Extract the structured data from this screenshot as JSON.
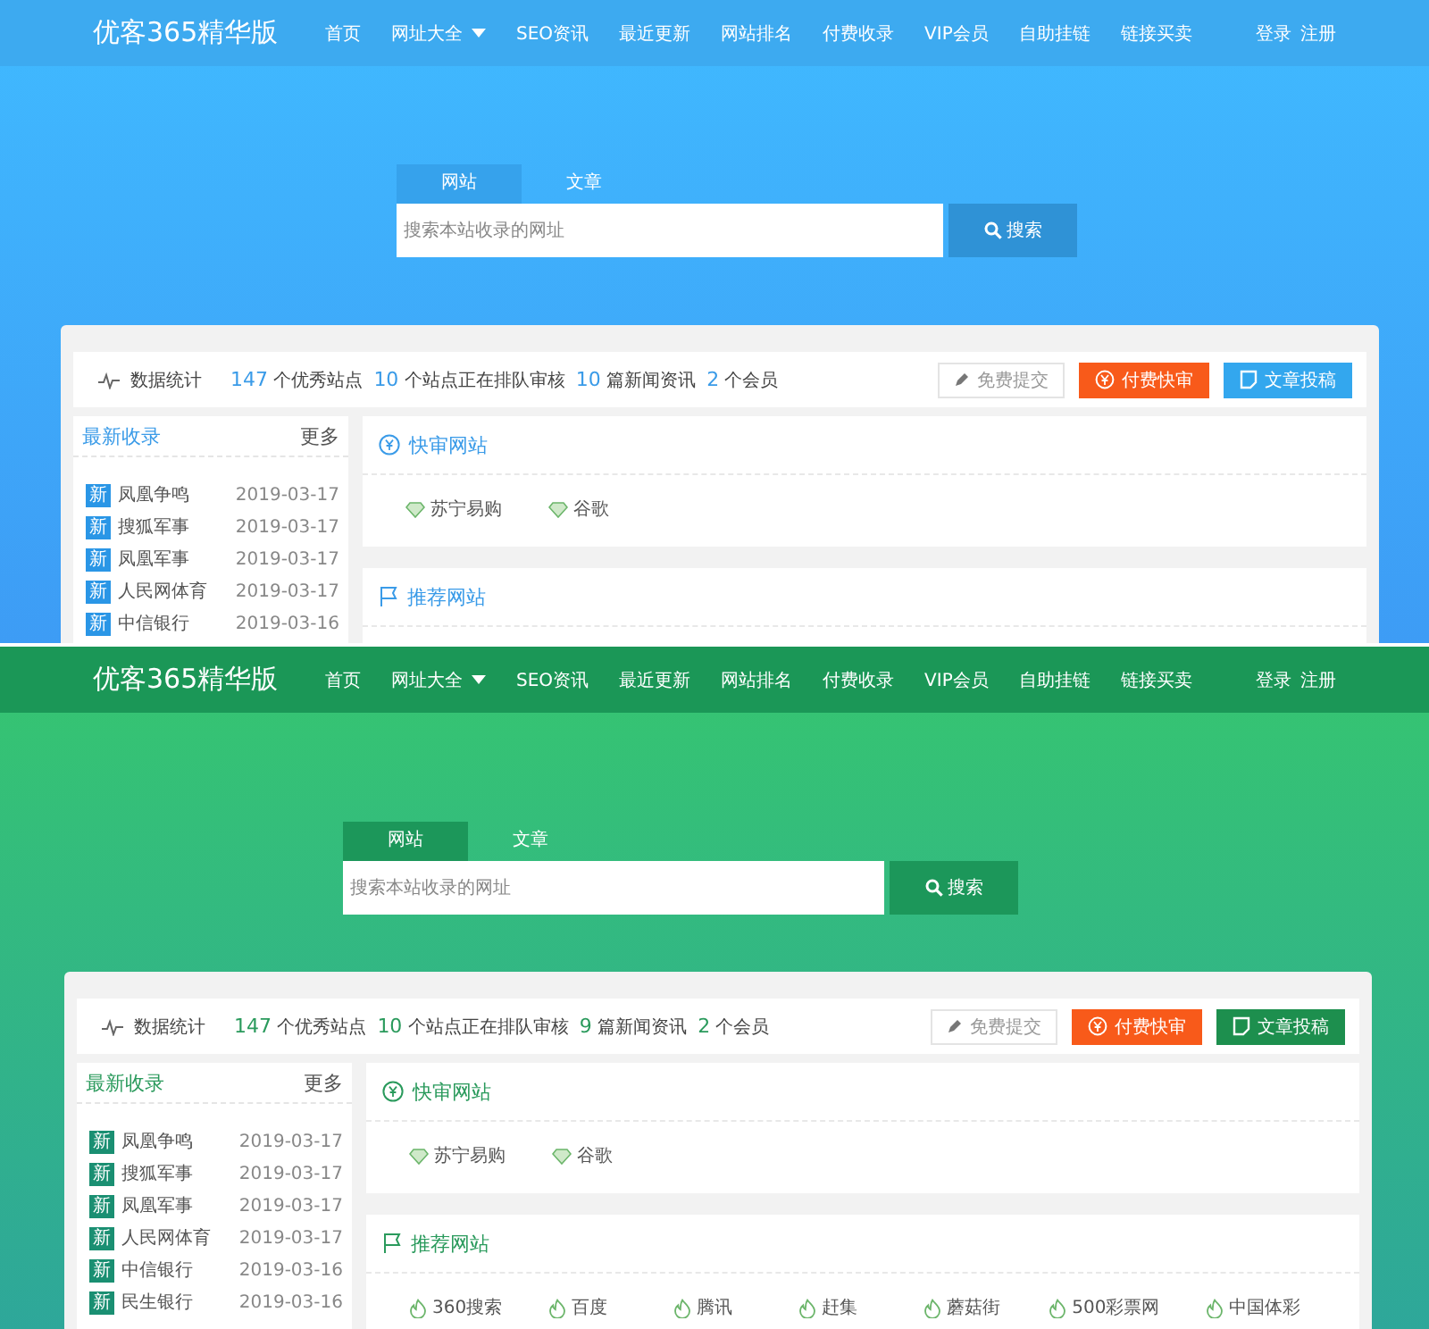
{
  "screenshots": [
    {
      "kind": "blue",
      "site_title": "优客365精华版",
      "nav": [
        {
          "label": "首页",
          "dropdown": false
        },
        {
          "label": "网址大全",
          "dropdown": true
        },
        {
          "label": "SEO资讯",
          "dropdown": false
        },
        {
          "label": "最近更新",
          "dropdown": false
        },
        {
          "label": "网站排名",
          "dropdown": false
        },
        {
          "label": "付费收录",
          "dropdown": false
        },
        {
          "label": "VIP会员",
          "dropdown": false
        },
        {
          "label": "自助挂链",
          "dropdown": false
        },
        {
          "label": "链接买卖",
          "dropdown": false
        }
      ],
      "auth": [
        "登录",
        "注册"
      ],
      "search": {
        "tabs": [
          {
            "label": "网站",
            "selected": true
          },
          {
            "label": "文章",
            "selected": false
          }
        ],
        "placeholder": "搜索本站收录的网址",
        "button": "搜索"
      },
      "stats": {
        "title": "数据统计",
        "items": [
          {
            "number": "147",
            "label": "个优秀站点"
          },
          {
            "number": "10",
            "label": "个站点正在排队审核"
          },
          {
            "number": "10",
            "label": "篇新闻资讯"
          },
          {
            "number": "2",
            "label": "个会员"
          }
        ]
      },
      "actions": [
        {
          "label": "免费提交",
          "kind": "plain"
        },
        {
          "label": "付费快审",
          "kind": "warning"
        },
        {
          "label": "文章投稿",
          "kind": "primary"
        }
      ],
      "latest": {
        "title": "最新收录",
        "more": "更多",
        "items": [
          {
            "badge": "新",
            "name": "凤凰争鸣",
            "date": "2019-03-17"
          },
          {
            "badge": "新",
            "name": "搜狐军事",
            "date": "2019-03-17"
          },
          {
            "badge": "新",
            "name": "凤凰军事",
            "date": "2019-03-17"
          },
          {
            "badge": "新",
            "name": "人民网体育",
            "date": "2019-03-17"
          },
          {
            "badge": "新",
            "name": "中信银行",
            "date": "2019-03-16"
          }
        ]
      },
      "sections": [
        {
          "title": "快审网站",
          "kind": "fast",
          "items": [
            "苏宁易购",
            "谷歌"
          ]
        },
        {
          "title": "推荐网站",
          "kind": "recommend"
        }
      ]
    },
    {
      "kind": "green",
      "site_title": "优客365精华版",
      "nav": [
        {
          "label": "首页",
          "dropdown": false
        },
        {
          "label": "网址大全",
          "dropdown": true
        },
        {
          "label": "SEO资讯",
          "dropdown": false
        },
        {
          "label": "最近更新",
          "dropdown": false
        },
        {
          "label": "网站排名",
          "dropdown": false
        },
        {
          "label": "付费收录",
          "dropdown": false
        },
        {
          "label": "VIP会员",
          "dropdown": false
        },
        {
          "label": "自助挂链",
          "dropdown": false
        },
        {
          "label": "链接买卖",
          "dropdown": false
        }
      ],
      "auth": [
        "登录",
        "注册"
      ],
      "search": {
        "tabs": [
          {
            "label": "网站",
            "selected": true
          },
          {
            "label": "文章",
            "selected": false
          }
        ],
        "placeholder": "搜索本站收录的网址",
        "button": "搜索"
      },
      "stats": {
        "title": "数据统计",
        "items": [
          {
            "number": "147",
            "label": "个优秀站点"
          },
          {
            "number": "10",
            "label": "个站点正在排队审核"
          },
          {
            "number": "9",
            "label": "篇新闻资讯"
          },
          {
            "number": "2",
            "label": "个会员"
          }
        ]
      },
      "actions": [
        {
          "label": "免费提交",
          "kind": "plain"
        },
        {
          "label": "付费快审",
          "kind": "warning"
        },
        {
          "label": "文章投稿",
          "kind": "primary"
        }
      ],
      "latest": {
        "title": "最新收录",
        "more": "更多",
        "items": [
          {
            "badge": "新",
            "name": "凤凰争鸣",
            "date": "2019-03-17"
          },
          {
            "badge": "新",
            "name": "搜狐军事",
            "date": "2019-03-17"
          },
          {
            "badge": "新",
            "name": "凤凰军事",
            "date": "2019-03-17"
          },
          {
            "badge": "新",
            "name": "人民网体育",
            "date": "2019-03-17"
          },
          {
            "badge": "新",
            "name": "中信银行",
            "date": "2019-03-16"
          },
          {
            "badge": "新",
            "name": "民生银行",
            "date": "2019-03-16"
          }
        ]
      },
      "sections": [
        {
          "title": "快审网站",
          "kind": "fast",
          "items": [
            "苏宁易购",
            "谷歌"
          ]
        },
        {
          "title": "推荐网站",
          "kind": "recommend",
          "items": [
            "360搜索",
            "百度",
            "腾讯",
            "赶集",
            "蘑菇街",
            "500彩票网",
            "中国体彩"
          ]
        }
      ]
    }
  ]
}
